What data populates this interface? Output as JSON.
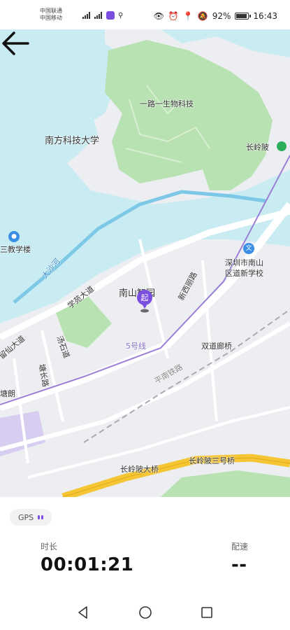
{
  "status_bar": {
    "carrier_1": "中国联通",
    "carrier_2": "中国移动",
    "battery": "92%",
    "time": "16:43"
  },
  "map": {
    "labels": {
      "campus": "南方科技大学",
      "park": "一路一生物科技",
      "station_changlingpi": "长岭陂",
      "school": "三教学楼",
      "new_school_line1": "深圳市南山",
      "new_school_line2": "区道新学校",
      "nanshan_park": "南山智园",
      "road_xueyuan": "学苑大道",
      "road_tangchang": "塘长路",
      "road_liuxian": "留仙大道",
      "road_tanglang": "塘朗",
      "road_shilong": "汤石道",
      "road_xili": "新西丽路",
      "metro_line": "5号线",
      "bridge_shuangdao": "双道廊桥",
      "bridge_changlingpi": "长岭陂大桥",
      "bridge_changlingpi_3": "长岭陂三号桥",
      "railway": "平南铁路",
      "river": "大沙河"
    },
    "start_marker": "起",
    "colors": {
      "water": "#c9ecf3",
      "green": "#b9e2b3",
      "road_major": "#f5c533",
      "route_purple": "#9b7fd6"
    }
  },
  "panel": {
    "gps_label": "GPS",
    "duration_label": "时长",
    "duration_value": "00:01:21",
    "pace_label": "配速",
    "pace_value": "--"
  }
}
